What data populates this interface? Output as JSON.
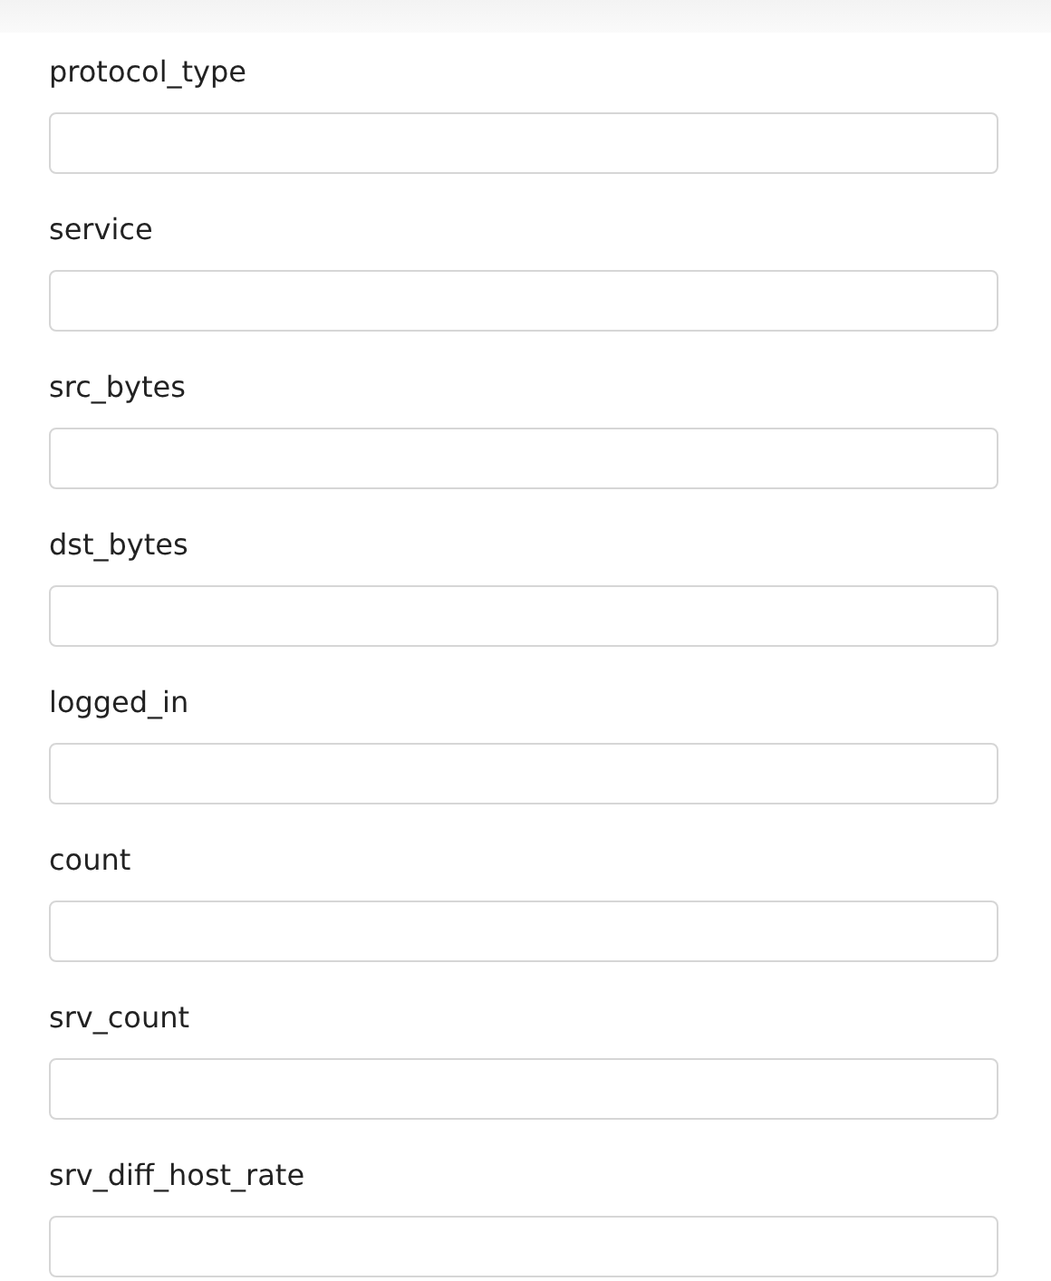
{
  "fields": [
    {
      "label": "protocol_type"
    },
    {
      "label": "service"
    },
    {
      "label": "src_bytes"
    },
    {
      "label": "dst_bytes"
    },
    {
      "label": "logged_in"
    },
    {
      "label": "count"
    },
    {
      "label": "srv_count"
    },
    {
      "label": "srv_diff_host_rate"
    }
  ]
}
